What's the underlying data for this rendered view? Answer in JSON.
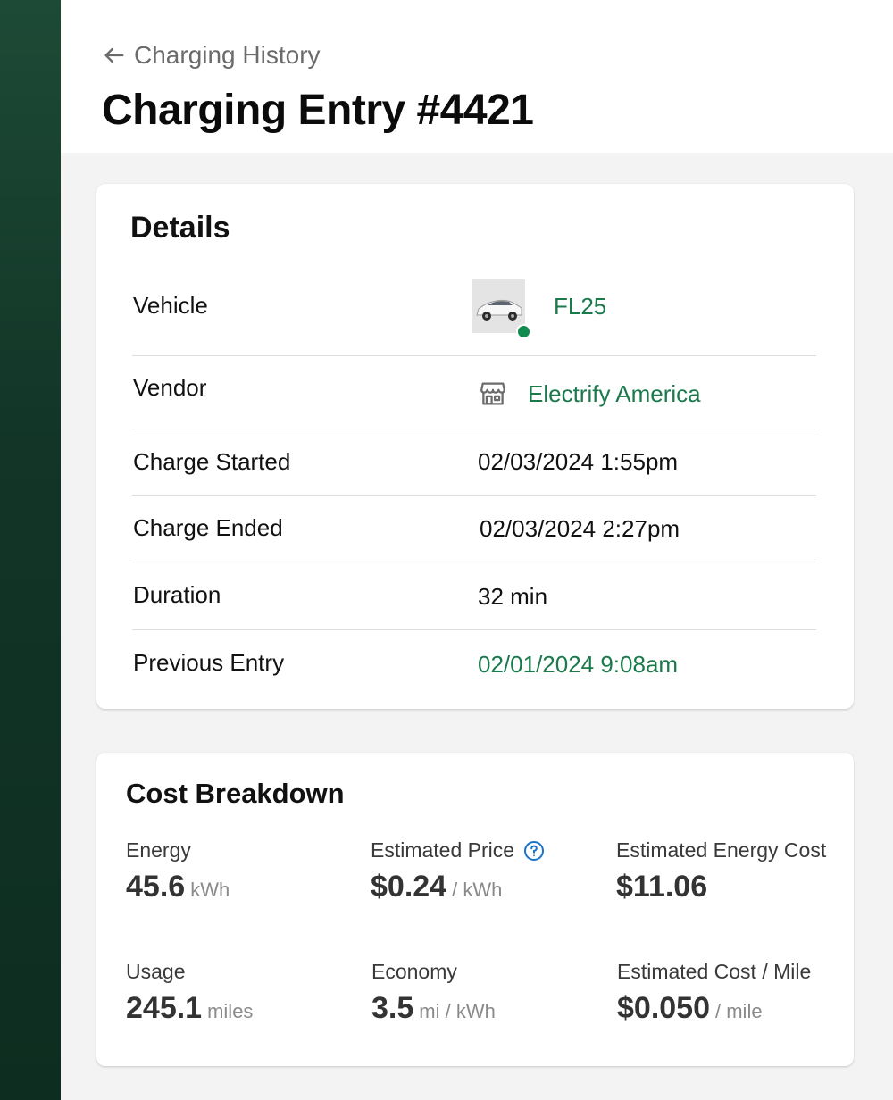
{
  "header": {
    "back_label": "Charging History",
    "title": "Charging Entry #4421"
  },
  "details": {
    "title": "Details",
    "rows": [
      {
        "label": "Vehicle",
        "value": "FL25"
      },
      {
        "label": "Vendor",
        "value": "Electrify America"
      },
      {
        "label": "Charge Started",
        "value": "02/03/2024 1:55pm"
      },
      {
        "label": "Charge Ended",
        "value": "02/03/2024 2:27pm"
      },
      {
        "label": "Duration",
        "value": "32 min"
      },
      {
        "label": "Previous Entry",
        "value": "02/01/2024 9:08am"
      }
    ]
  },
  "cost": {
    "title": "Cost Breakdown",
    "metrics": [
      {
        "label": "Energy",
        "value": "45.6",
        "unit": "kWh"
      },
      {
        "label": "Estimated Price",
        "value": "$0.24",
        "unit": "/ kWh"
      },
      {
        "label": "Estimated Energy Cost",
        "value": "$11.06",
        "unit": ""
      },
      {
        "label": "Usage",
        "value": "245.1",
        "unit": "miles"
      },
      {
        "label": "Economy",
        "value": "3.5",
        "unit": "mi / kWh"
      },
      {
        "label": "Estimated Cost / Mile",
        "value": "$0.050",
        "unit": "/ mile"
      }
    ]
  },
  "colors": {
    "accent_green": "#1b7a4b",
    "status_online": "#138a4e",
    "sidebar": "#123527",
    "help_blue": "#1a73c9"
  },
  "icons": {
    "back": "arrow-left-icon",
    "vendor": "storefront-icon",
    "help": "question-circle-icon"
  }
}
